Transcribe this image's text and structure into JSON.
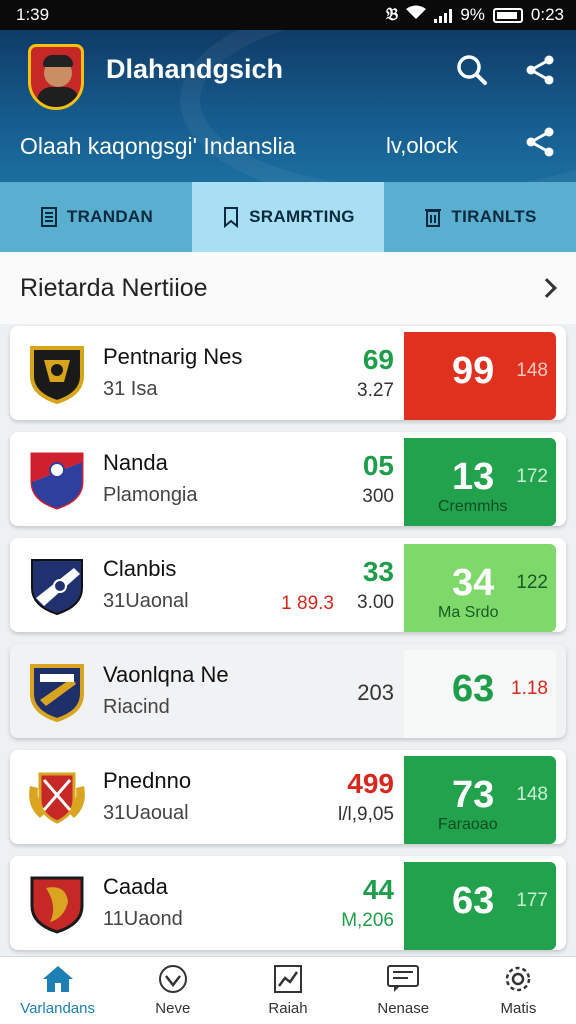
{
  "status": {
    "time_left": "1:39",
    "battery_pct": "9%",
    "time_right": "0:23"
  },
  "header": {
    "app_title": "Dlahandgsich",
    "subtitle": "Olaah kaqongsgi' Indanslia",
    "subnote": "lv,olock"
  },
  "tabs": [
    {
      "label": "TRANDAN",
      "icon": "document-icon"
    },
    {
      "label": "SRAMRTING",
      "icon": "bookmark-icon"
    },
    {
      "label": "TIRANLTS",
      "icon": "trash-icon"
    }
  ],
  "section": {
    "title": "Rietarda Nertiioe"
  },
  "matches": [
    {
      "name": "Pentnarig Nes",
      "sub": "31 Isa",
      "stat_top": "69",
      "stat_sub": "3.27",
      "stat_extra": "",
      "score": "99",
      "score_side": "148",
      "score_caption": "",
      "color": "#e0301e"
    },
    {
      "name": "Nanda",
      "sub": "Plamongia",
      "stat_top": "05",
      "stat_sub": "300",
      "stat_extra": "",
      "score": "13",
      "score_side": "172",
      "score_caption": "Cremmhs",
      "color": "#23a24d"
    },
    {
      "name": "Clanbis",
      "sub": "31Uaonal",
      "stat_top": "33",
      "stat_sub": "3.00",
      "stat_extra": "1 89.3",
      "score": "34",
      "score_side": "122",
      "score_caption": "Ma Srdo",
      "color": "#7fd86a"
    },
    {
      "name": "Vaonlqna Ne",
      "sub": "Riacind",
      "stat_top": "",
      "stat_sub": "203",
      "stat_extra": "",
      "score": "63",
      "score_side": "1.18",
      "score_caption": "",
      "color": "#f7f8f8"
    },
    {
      "name": "Pnednno",
      "sub": "31Uaoual",
      "stat_top": "499",
      "stat_sub": "l/l,9,05",
      "stat_extra": "",
      "score": "73",
      "score_side": "148",
      "score_caption": "Faraoao",
      "color": "#23a24d"
    },
    {
      "name": "Caada",
      "sub": "11Uaond",
      "stat_top": "44",
      "stat_sub": "M,206",
      "stat_extra": "",
      "score": "63",
      "score_side": "177",
      "score_caption": "",
      "color": "#23a24d"
    }
  ],
  "bottom_nav": [
    {
      "label": "Varlandans",
      "icon": "home-icon"
    },
    {
      "label": "Neve",
      "icon": "heart-icon"
    },
    {
      "label": "Raiah",
      "icon": "chart-icon"
    },
    {
      "label": "Nenase",
      "icon": "message-icon"
    },
    {
      "label": "Matis",
      "icon": "settings-icon"
    }
  ]
}
